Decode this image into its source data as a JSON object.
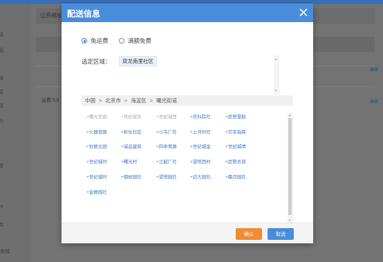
{
  "background": {
    "tab_label": "运费模板",
    "row_text": "运费 5.0",
    "edit_label": "编辑",
    "bottom_text": "商城",
    "sidebar_chars": [
      "设",
      "配",
      "运",
      "店",
      "程",
      "价",
      "管",
      "户",
      "商"
    ]
  },
  "dialog": {
    "title": "配送信息",
    "close_icon": "close-icon",
    "options": [
      {
        "label": "免运费",
        "selected": true
      },
      {
        "label": "满额免费",
        "selected": false
      }
    ],
    "region_label": "选定区域：",
    "selected_regions": [
      "双龙南里社区"
    ],
    "breadcrumb": [
      "中国",
      "北京市",
      "海淀区",
      "曙光街道"
    ],
    "breadcrumb_sep": ">",
    "areas": [
      {
        "label": "+曙光花园",
        "enabled": false
      },
      {
        "label": "+世纪城东",
        "enabled": false
      },
      {
        "label": "+世纪城西",
        "enabled": false
      },
      {
        "label": "+农科院社",
        "enabled": true
      },
      {
        "label": "+武警雷毅",
        "enabled": true
      },
      {
        "label": "+火器营路",
        "enabled": true
      },
      {
        "label": "+彰化社区",
        "enabled": true
      },
      {
        "label": "+小屯厂社",
        "enabled": true
      },
      {
        "label": "+上河村社",
        "enabled": true
      },
      {
        "label": "+空军指挥",
        "enabled": true
      },
      {
        "label": "+怡丽北园",
        "enabled": true
      },
      {
        "label": "+诚品建筑",
        "enabled": true
      },
      {
        "label": "+四季青路",
        "enabled": true
      },
      {
        "label": "+世纪城金",
        "enabled": true
      },
      {
        "label": "+世纪城晴",
        "enabled": true
      },
      {
        "label": "+世纪城时",
        "enabled": true
      },
      {
        "label": "+曙光村",
        "enabled": true
      },
      {
        "label": "+兰靛厂社",
        "enabled": true
      },
      {
        "label": "+望塔西村",
        "enabled": true
      },
      {
        "label": "+武警总部",
        "enabled": true
      },
      {
        "label": "+世纪城时",
        "enabled": true
      },
      {
        "label": "+烟树园社",
        "enabled": true
      },
      {
        "label": "+望塔园社",
        "enabled": true
      },
      {
        "label": "+远大园社",
        "enabled": true
      },
      {
        "label": "+晨月园社",
        "enabled": true
      },
      {
        "label": "+金雅园社",
        "enabled": true
      }
    ],
    "confirm_label": "确认",
    "cancel_label": "取消",
    "colors": {
      "header": "#4a8ddb",
      "confirm": "#ef8d33",
      "cancel": "#4a8ddb",
      "link": "#4078c0",
      "disabled": "#a9a9a9"
    }
  }
}
